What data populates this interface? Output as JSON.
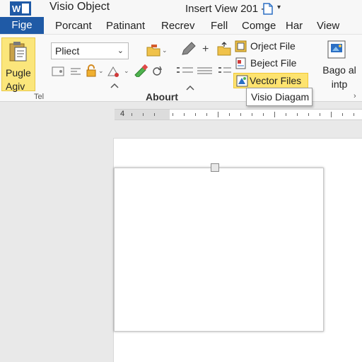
{
  "window": {
    "app_icon_letter": "W",
    "title": "Visio Object",
    "doc_title": "Insert View 201 -",
    "doc_caret": "▾"
  },
  "file_tab": {
    "label": "Fige"
  },
  "tabs": [
    {
      "label": "Porcant"
    },
    {
      "label": "Patinant"
    },
    {
      "label": "Recrev"
    },
    {
      "label": "Fell"
    },
    {
      "label": "Comge"
    },
    {
      "label": "Har"
    },
    {
      "label": "View"
    }
  ],
  "ribbon": {
    "paste": {
      "line1": "Pugle",
      "line2": "Agiv"
    },
    "font_combo": {
      "value": "Pliect",
      "caret": "⌄"
    },
    "left_group_label": "Tel",
    "group_label": "Abourt",
    "insert_items": [
      {
        "label": "Orject File"
      },
      {
        "label": "Beject File"
      },
      {
        "label": "Vector Files"
      }
    ],
    "tooltip": "Visio Diagam",
    "right_button": {
      "line1": "Bago al",
      "line2": "intp"
    },
    "collapse_glyph": "›"
  },
  "ruler": {
    "start_number": "4"
  },
  "colors": {
    "accent": "#1f5aa6",
    "highlight": "#fde36f",
    "page": "#ffffff",
    "workspace": "#e9e9e9"
  }
}
